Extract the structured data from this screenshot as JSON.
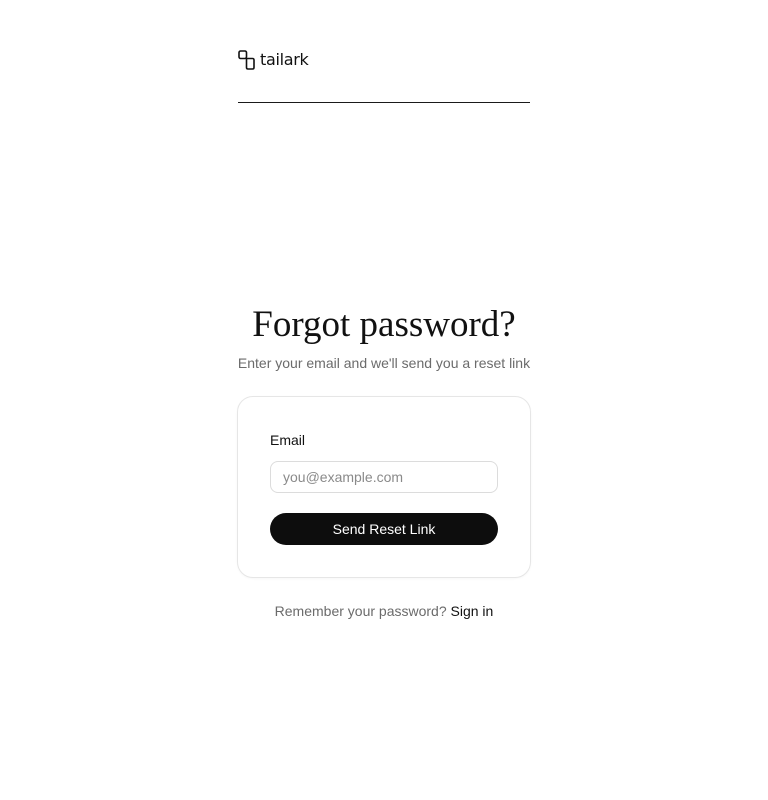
{
  "brand": {
    "name": "tailark",
    "logo_icon": "tailark-logo-icon"
  },
  "page": {
    "title": "Forgot password?",
    "subtitle": "Enter your email and we'll send you a reset link"
  },
  "form": {
    "email_label": "Email",
    "email_value": "",
    "email_placeholder": "you@example.com",
    "submit_label": "Send Reset Link"
  },
  "footer": {
    "prompt": "Remember your password?",
    "signin_label": "Sign in"
  },
  "colors": {
    "button_background": "#0d0d0d",
    "button_text": "#ffffff",
    "muted_text": "#6b6b6b",
    "border": "#e6e6e6"
  }
}
